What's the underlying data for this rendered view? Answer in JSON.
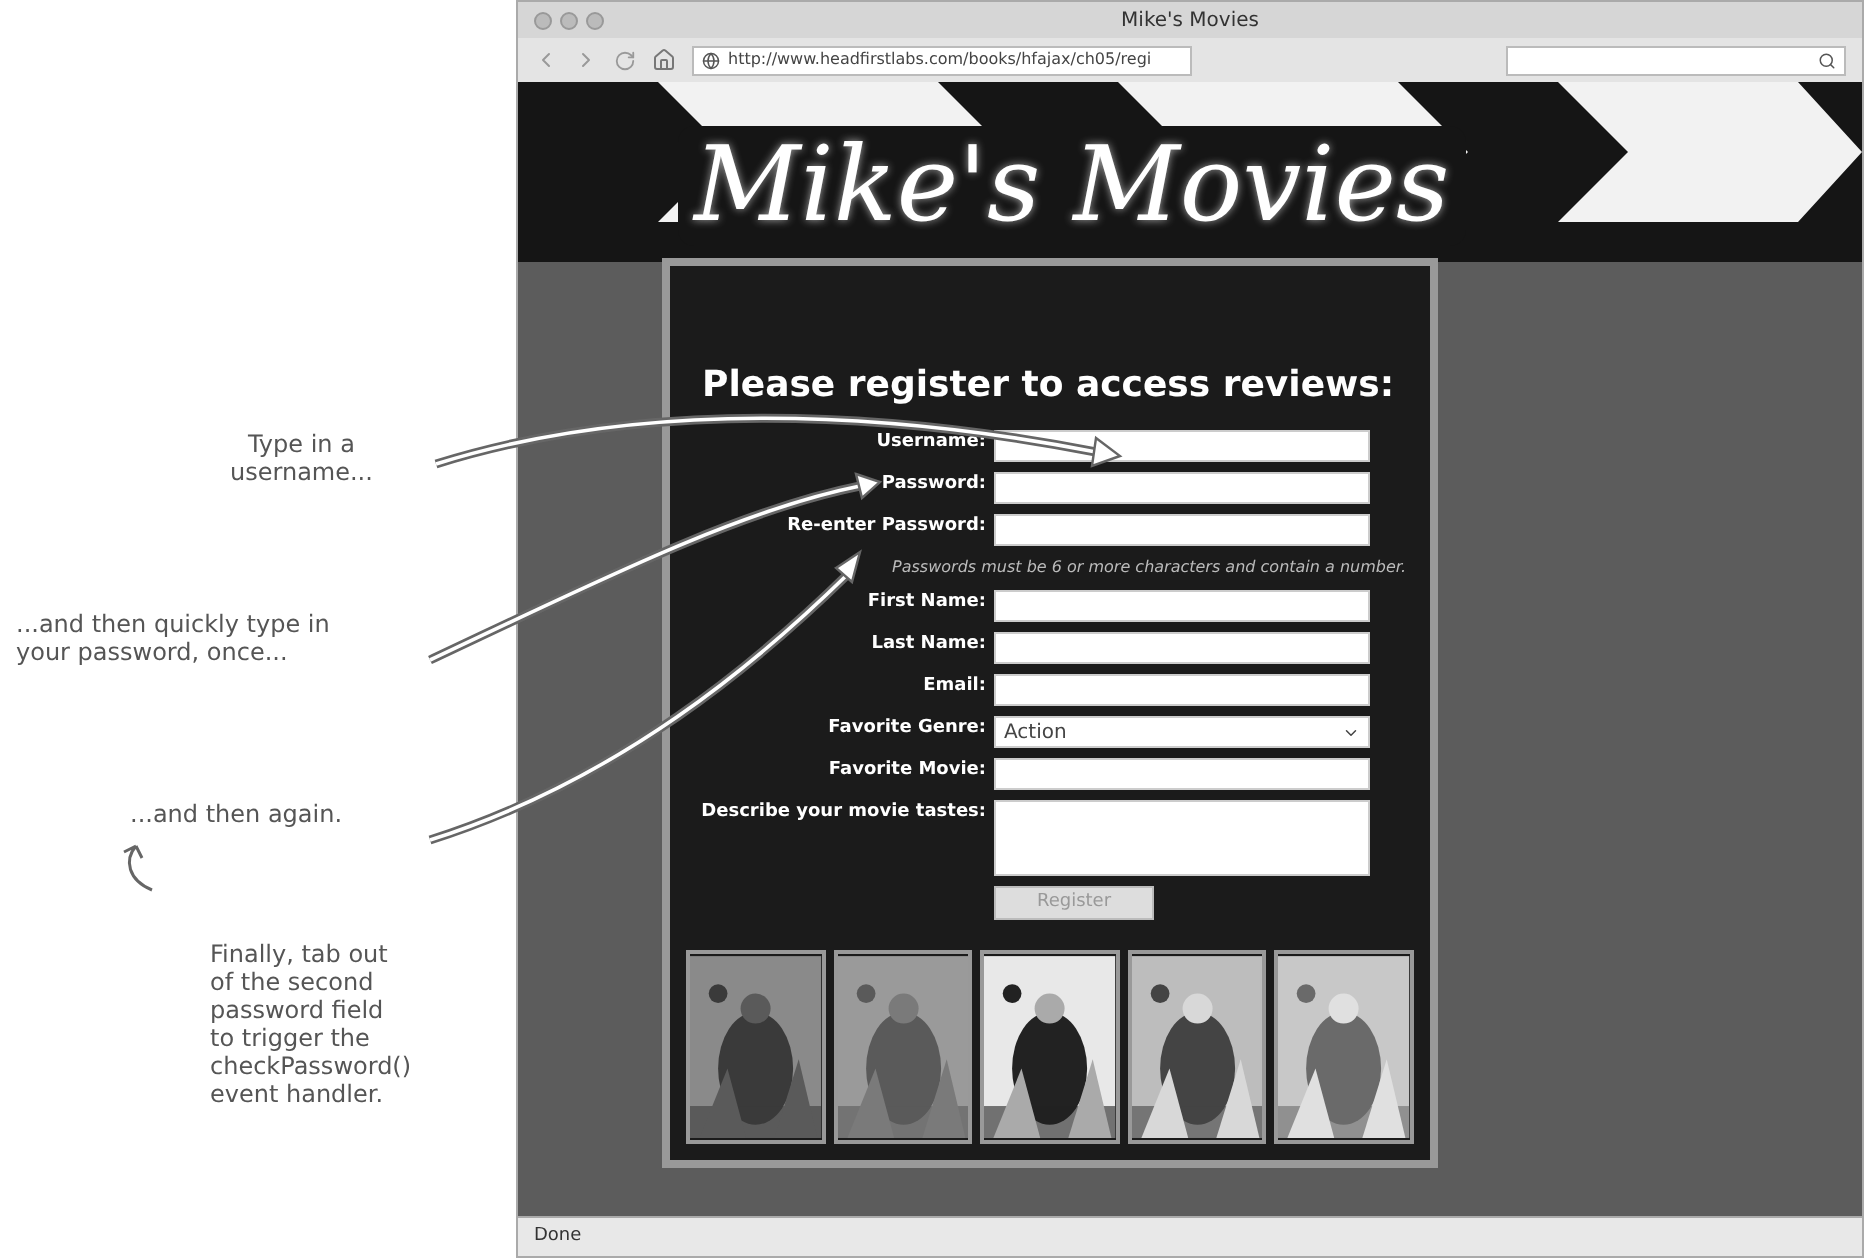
{
  "annotations": [
    {
      "lines": [
        "Type in a",
        "username..."
      ]
    },
    {
      "lines": [
        "...and then quickly type in",
        "your password, once..."
      ]
    },
    {
      "lines": [
        "...and then again."
      ]
    },
    {
      "lines": [
        "Finally, tab out",
        "of the second",
        "password field",
        "to trigger the",
        "checkPassword()",
        "event handler."
      ]
    }
  ],
  "browser": {
    "title": "Mike's Movies",
    "url": "http://www.headfirstlabs.com/books/hfajax/ch05/regi",
    "status": "Done"
  },
  "page": {
    "logo": "Mike's Movies",
    "heading": "Please register to access reviews:",
    "rows": [
      {
        "kind": "text",
        "label": "Username:"
      },
      {
        "kind": "text",
        "label": "Password:"
      },
      {
        "kind": "text",
        "label": "Re-enter Password:"
      },
      {
        "kind": "note",
        "text": "Passwords must be 6 or more characters and contain a number."
      },
      {
        "kind": "text",
        "label": "First Name:"
      },
      {
        "kind": "text",
        "label": "Last Name:"
      },
      {
        "kind": "text",
        "label": "Email:"
      },
      {
        "kind": "select",
        "label": "Favorite Genre:",
        "value": "Action"
      },
      {
        "kind": "text",
        "label": "Favorite Movie:"
      },
      {
        "kind": "textarea",
        "label": "Describe your movie tastes:"
      }
    ],
    "button": {
      "label": "Register",
      "disabled": true
    }
  }
}
